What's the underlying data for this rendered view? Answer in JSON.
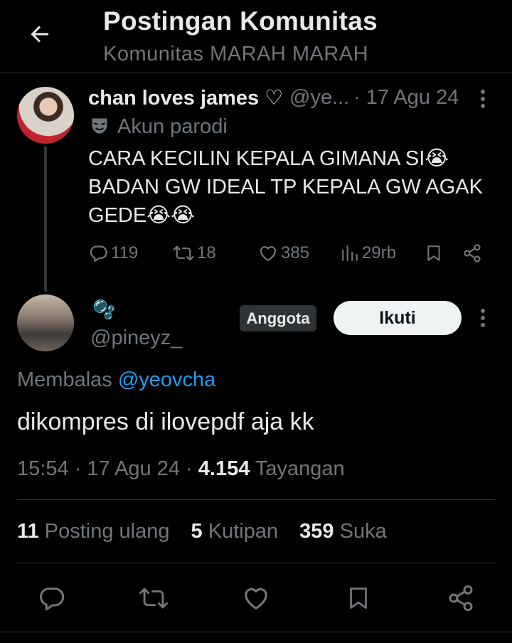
{
  "header": {
    "title": "Postingan Komunitas",
    "subtitle": "Komunitas MARAH MARAH",
    "back_icon": "arrow-left-icon"
  },
  "parent_tweet": {
    "display_name": "chan loves james ♡",
    "handle": "@ye...",
    "date": "· 17 Agu 24",
    "parody_label": "Akun parodi",
    "text": "CARA KECILIN KEPALA GIMANA SI😭\nBADAN GW IDEAL TP KEPALA GW AGAK\nGEDE😭😭",
    "replies": "119",
    "reposts": "18",
    "likes": "385",
    "views": "29rb"
  },
  "reply_tweet": {
    "emoji_name": "🫧",
    "handle": "@pineyz_",
    "badge": "Anggota",
    "follow_label": "Ikuti",
    "reply_prefix": "Membalas",
    "reply_mention": "@yeovcha",
    "text": "dikompres di ilovepdf aja kk",
    "time": "15:54",
    "date": "· 17 Agu 24 ·",
    "views_count": "4.154",
    "views_label": "Tayangan"
  },
  "stats": {
    "reposts_count": "11",
    "reposts_label": "Posting ulang",
    "quotes_count": "5",
    "quotes_label": "Kutipan",
    "likes_count": "359",
    "likes_label": "Suka"
  },
  "colors": {
    "background": "#000000",
    "text": "#e7e9ea",
    "muted": "#71767b",
    "accent": "#1d9bf0",
    "divider": "#2f3336"
  }
}
